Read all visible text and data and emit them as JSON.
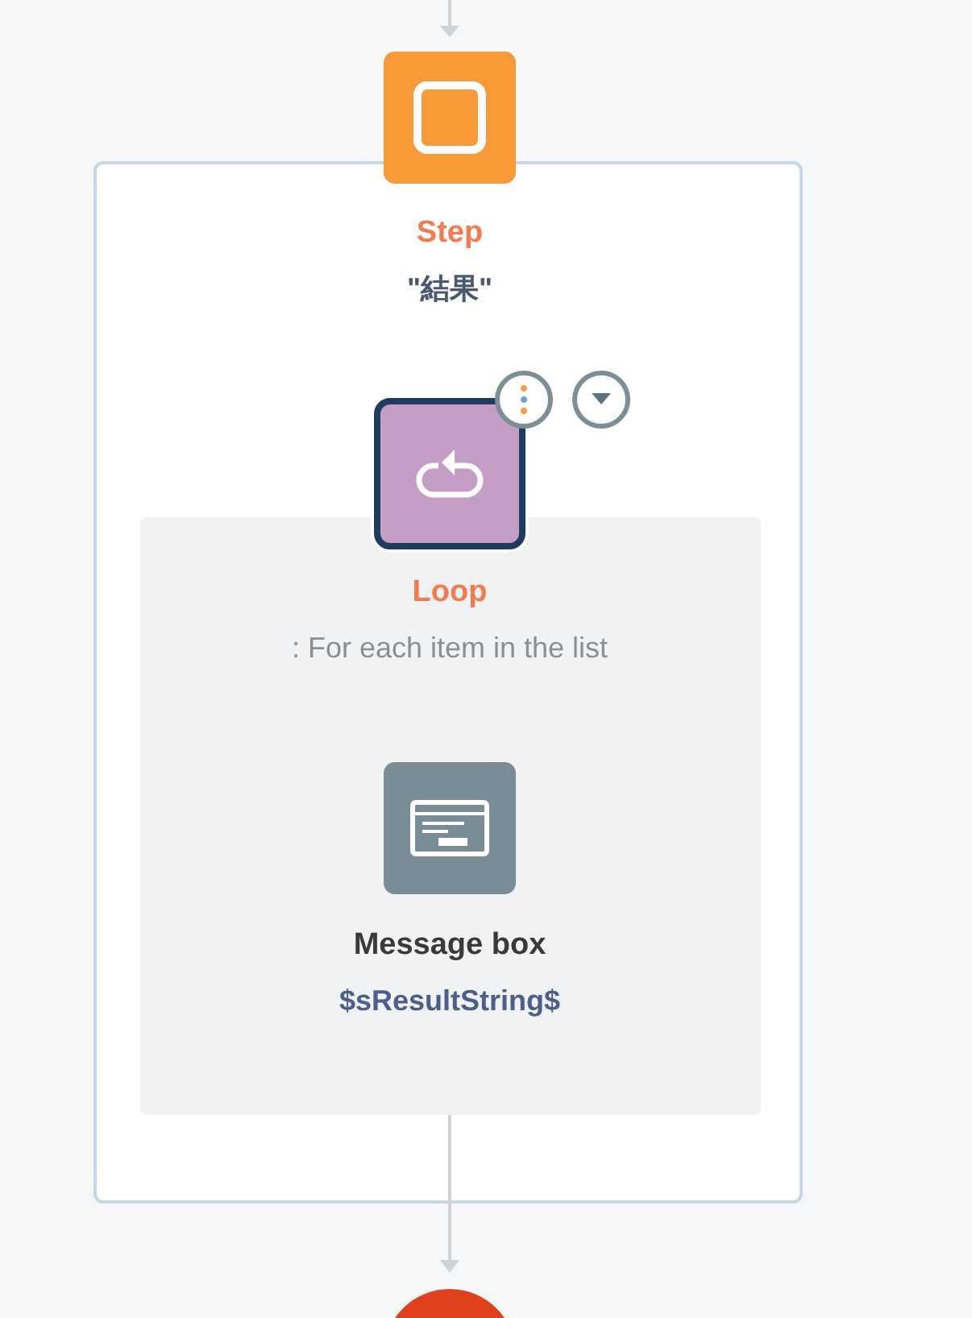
{
  "step": {
    "kind": "step",
    "title": "Step",
    "subtitle": "\"結果\"",
    "selected": false
  },
  "loop": {
    "kind": "loop",
    "title": "Loop",
    "subtitle": ": For each item in the list",
    "selected": true
  },
  "action": {
    "kind": "message",
    "title": "Message box",
    "subtitle": "$sResultString$",
    "selected": false
  }
}
